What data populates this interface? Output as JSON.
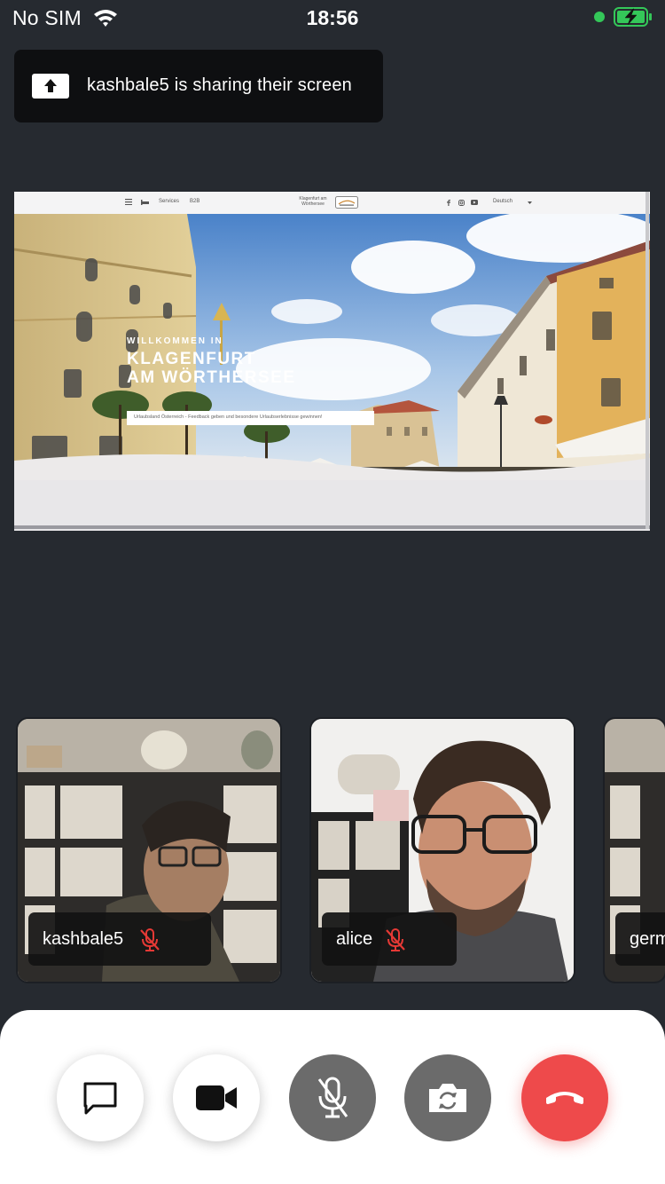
{
  "status_bar": {
    "carrier": "No SIM",
    "time": "18:56",
    "camera_dot_color": "#34c759",
    "battery_color": "#34c759"
  },
  "share_banner": {
    "text": "kashbale5 is sharing their screen",
    "icon": "upload-arrow-icon"
  },
  "shared_screen": {
    "nav": {
      "menu_icon": "hamburger-icon",
      "items": [
        "Services",
        "B2B"
      ],
      "logo_text": "Klagenfurt am Wörthersee",
      "social_icons": [
        "facebook-icon",
        "instagram-icon",
        "youtube-icon"
      ],
      "language": "Deutsch"
    },
    "hero": {
      "pre_title": "WILLKOMMEN IN",
      "title_line1": "KLAGENFURT",
      "title_line2": "AM WÖRTHERSEE",
      "banner_text": "Urlaubsland Österreich - Feedback geben und besondere Urlaubserlebnisse gewinnen!"
    }
  },
  "participants": [
    {
      "name": "kashbale5",
      "muted": true
    },
    {
      "name": "alice",
      "muted": true
    },
    {
      "name": "germ",
      "muted": true
    }
  ],
  "controls": [
    {
      "name": "chat",
      "icon": "chat-bubble-icon"
    },
    {
      "name": "camera",
      "icon": "video-camera-icon"
    },
    {
      "name": "mute",
      "icon": "mic-off-icon"
    },
    {
      "name": "flip-camera",
      "icon": "camera-switch-icon"
    },
    {
      "name": "end-call",
      "icon": "phone-hangup-icon"
    }
  ],
  "colors": {
    "background": "#262a30",
    "mute_red": "#e53935",
    "end_call": "#ee4a4b",
    "control_grey": "#6b6b6b"
  }
}
